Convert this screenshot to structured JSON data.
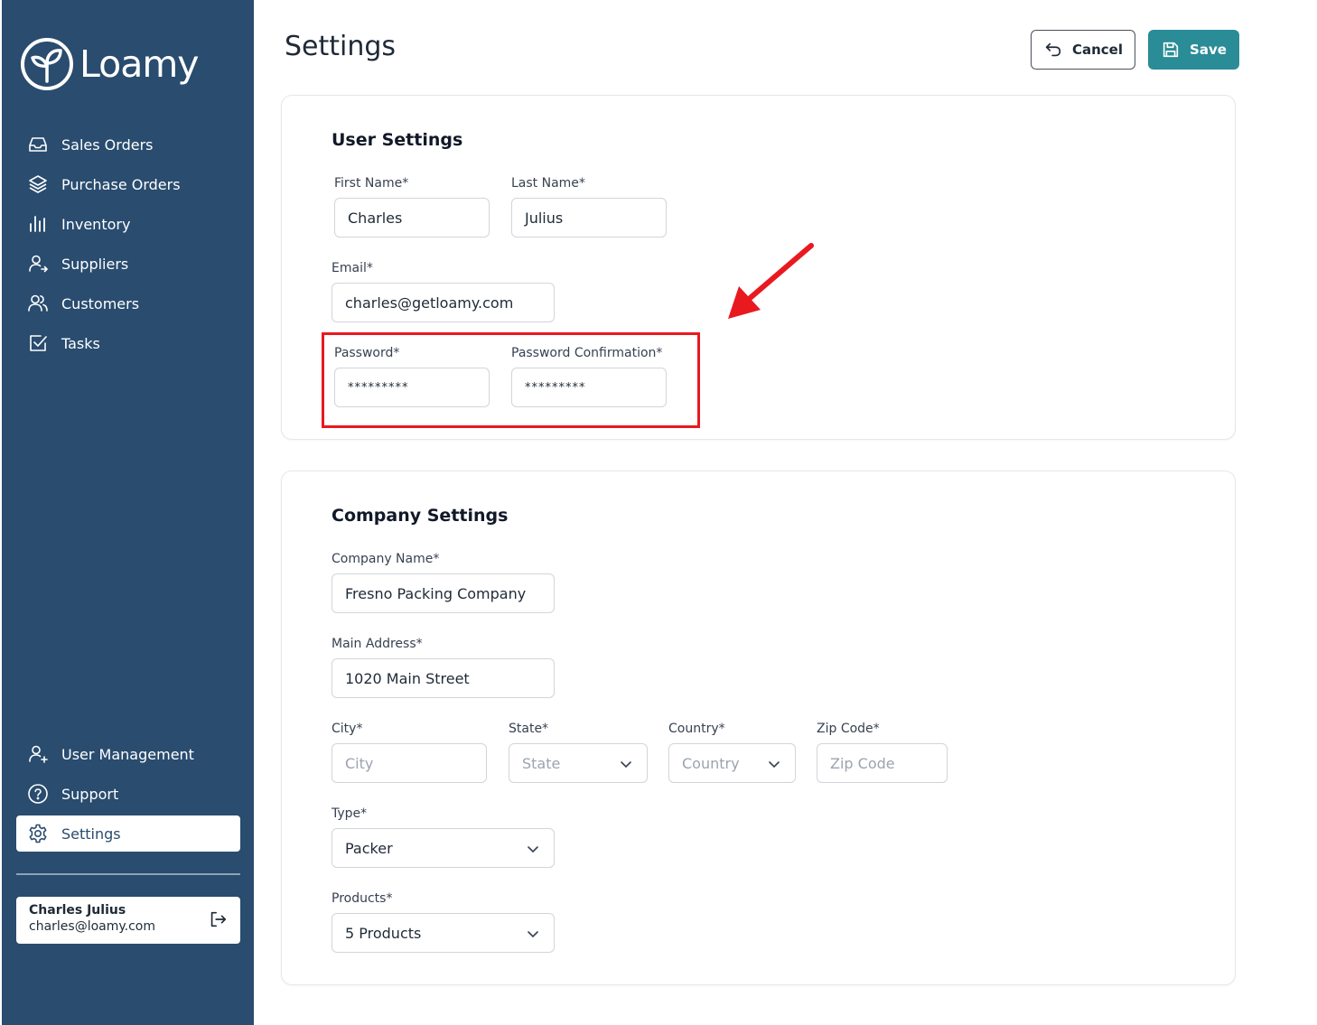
{
  "brand": {
    "name": "Loamy"
  },
  "sidebar": {
    "items": [
      {
        "label": "Sales Orders",
        "icon": "inbox-icon"
      },
      {
        "label": "Purchase Orders",
        "icon": "layers-icon"
      },
      {
        "label": "Inventory",
        "icon": "bar-chart-icon"
      },
      {
        "label": "Suppliers",
        "icon": "user-arrow-icon"
      },
      {
        "label": "Customers",
        "icon": "users-icon"
      },
      {
        "label": "Tasks",
        "icon": "checkbox-icon"
      }
    ],
    "bottom_items": [
      {
        "label": "User Management",
        "icon": "user-plus-icon"
      },
      {
        "label": "Support",
        "icon": "help-circle-icon"
      },
      {
        "label": "Settings",
        "icon": "gear-icon",
        "active": true
      }
    ],
    "user": {
      "name": "Charles Julius",
      "email": "charles@loamy.com"
    }
  },
  "header": {
    "title": "Settings",
    "cancel_label": "Cancel",
    "save_label": "Save"
  },
  "user_settings": {
    "title": "User Settings",
    "first_name": {
      "label": "First Name*",
      "value": "Charles"
    },
    "last_name": {
      "label": "Last Name*",
      "value": "Julius"
    },
    "email": {
      "label": "Email*",
      "value": "charles@getloamy.com"
    },
    "password": {
      "label": "Password*",
      "value": "*********"
    },
    "password_confirmation": {
      "label": "Password Confirmation*",
      "value": "*********"
    }
  },
  "company_settings": {
    "title": "Company Settings",
    "company_name": {
      "label": "Company Name*",
      "value": "Fresno Packing Company"
    },
    "main_address": {
      "label": "Main Address*",
      "value": "1020 Main Street"
    },
    "city": {
      "label": "City*",
      "placeholder": "City"
    },
    "state": {
      "label": "State*",
      "placeholder": "State"
    },
    "country": {
      "label": "Country*",
      "placeholder": "Country"
    },
    "zip": {
      "label": "Zip Code*",
      "placeholder": "Zip Code"
    },
    "type": {
      "label": "Type*",
      "value": "Packer"
    },
    "products": {
      "label": "Products*",
      "value": "5 Products"
    }
  },
  "colors": {
    "sidebar": "#294c6f",
    "accent": "#2a8c96",
    "annotation": "#e8191f"
  }
}
